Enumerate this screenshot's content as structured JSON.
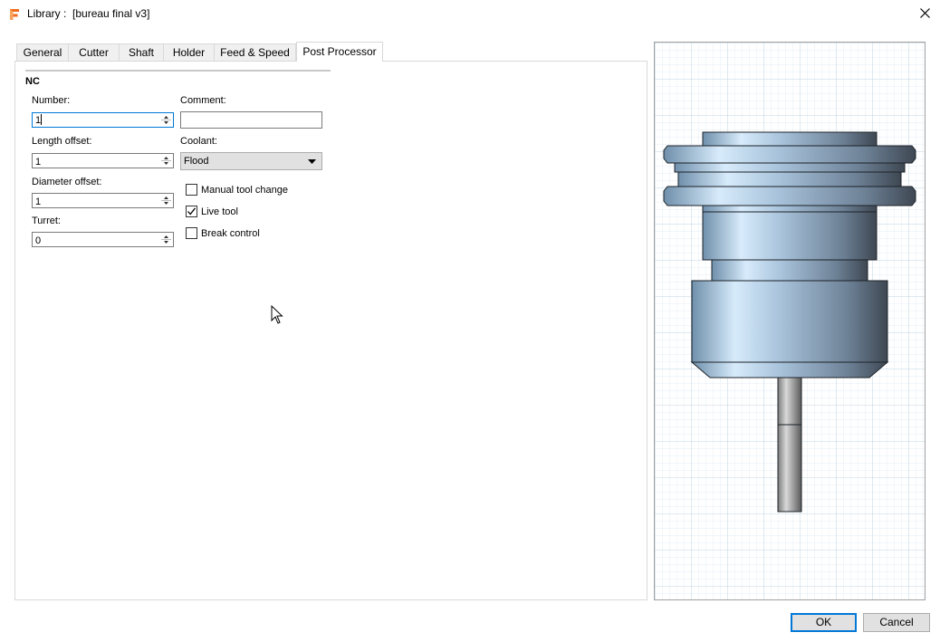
{
  "window": {
    "title": "Library :  [bureau final v3]",
    "app_icon": "fusion-logo-icon",
    "close_icon": "close-icon"
  },
  "tabs": [
    {
      "label": "General"
    },
    {
      "label": "Cutter"
    },
    {
      "label": "Shaft"
    },
    {
      "label": "Holder"
    },
    {
      "label": "Feed & Speed"
    },
    {
      "label": "Post Processor",
      "active": true
    }
  ],
  "nc": {
    "heading": "NC",
    "number": {
      "label": "Number:",
      "value": "1"
    },
    "comment": {
      "label": "Comment:",
      "value": ""
    },
    "length_offset": {
      "label": "Length offset:",
      "value": "1"
    },
    "coolant": {
      "label": "Coolant:",
      "value": "Flood"
    },
    "diameter_offset": {
      "label": "Diameter offset:",
      "value": "1"
    },
    "turret": {
      "label": "Turret:",
      "value": "0"
    },
    "manual_tool_change": {
      "label": "Manual tool change",
      "checked": false
    },
    "live_tool": {
      "label": "Live tool",
      "checked": true
    },
    "break_control": {
      "label": "Break control",
      "checked": false
    }
  },
  "buttons": {
    "ok": "OK",
    "cancel": "Cancel"
  },
  "colors": {
    "accent": "#0078d7",
    "holder_light": "#d2e6f8",
    "holder_mid": "#8fb0cc",
    "holder_dark": "#45505c",
    "grid_line": "#c7dbe8"
  }
}
